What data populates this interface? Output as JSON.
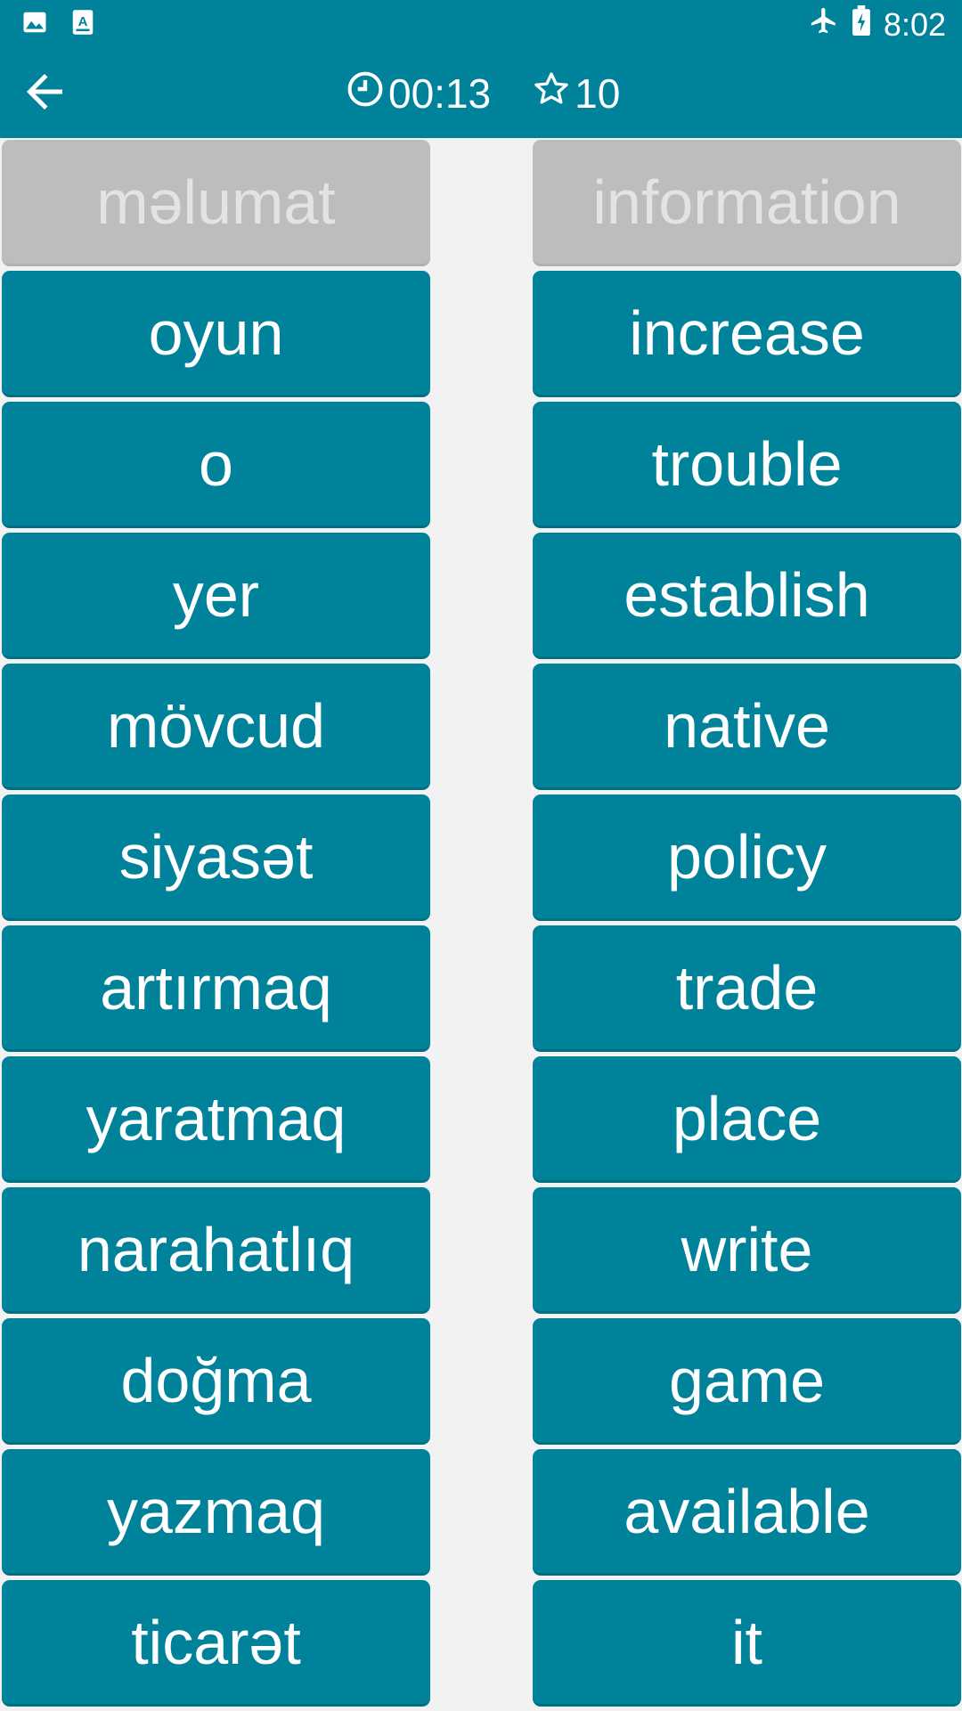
{
  "status": {
    "time": "8:02",
    "left_icons": [
      "image-icon",
      "text-icon"
    ],
    "right_icons": [
      "airplane-icon",
      "battery-charging-icon"
    ]
  },
  "toolbar": {
    "back_icon": "arrow-left-icon",
    "timer": "00:13",
    "score": "10"
  },
  "colors": {
    "primary": "#00839a",
    "matched": "#bdbdbd",
    "background": "#f2f2f2"
  },
  "left_words": [
    {
      "text": "məlumat",
      "matched": true
    },
    {
      "text": "oyun",
      "matched": false
    },
    {
      "text": "o",
      "matched": false
    },
    {
      "text": "yer",
      "matched": false
    },
    {
      "text": "mövcud",
      "matched": false
    },
    {
      "text": "siyasət",
      "matched": false
    },
    {
      "text": "artırmaq",
      "matched": false
    },
    {
      "text": "yaratmaq",
      "matched": false
    },
    {
      "text": "narahatlıq",
      "matched": false
    },
    {
      "text": "doğma",
      "matched": false
    },
    {
      "text": "yazmaq",
      "matched": false
    },
    {
      "text": "ticarət",
      "matched": false
    }
  ],
  "right_words": [
    {
      "text": "information",
      "matched": true
    },
    {
      "text": "increase",
      "matched": false
    },
    {
      "text": "trouble",
      "matched": false
    },
    {
      "text": "establish",
      "matched": false
    },
    {
      "text": "native",
      "matched": false
    },
    {
      "text": "policy",
      "matched": false
    },
    {
      "text": "trade",
      "matched": false
    },
    {
      "text": "place",
      "matched": false
    },
    {
      "text": "write",
      "matched": false
    },
    {
      "text": "game",
      "matched": false
    },
    {
      "text": "available",
      "matched": false
    },
    {
      "text": "it",
      "matched": false
    }
  ]
}
